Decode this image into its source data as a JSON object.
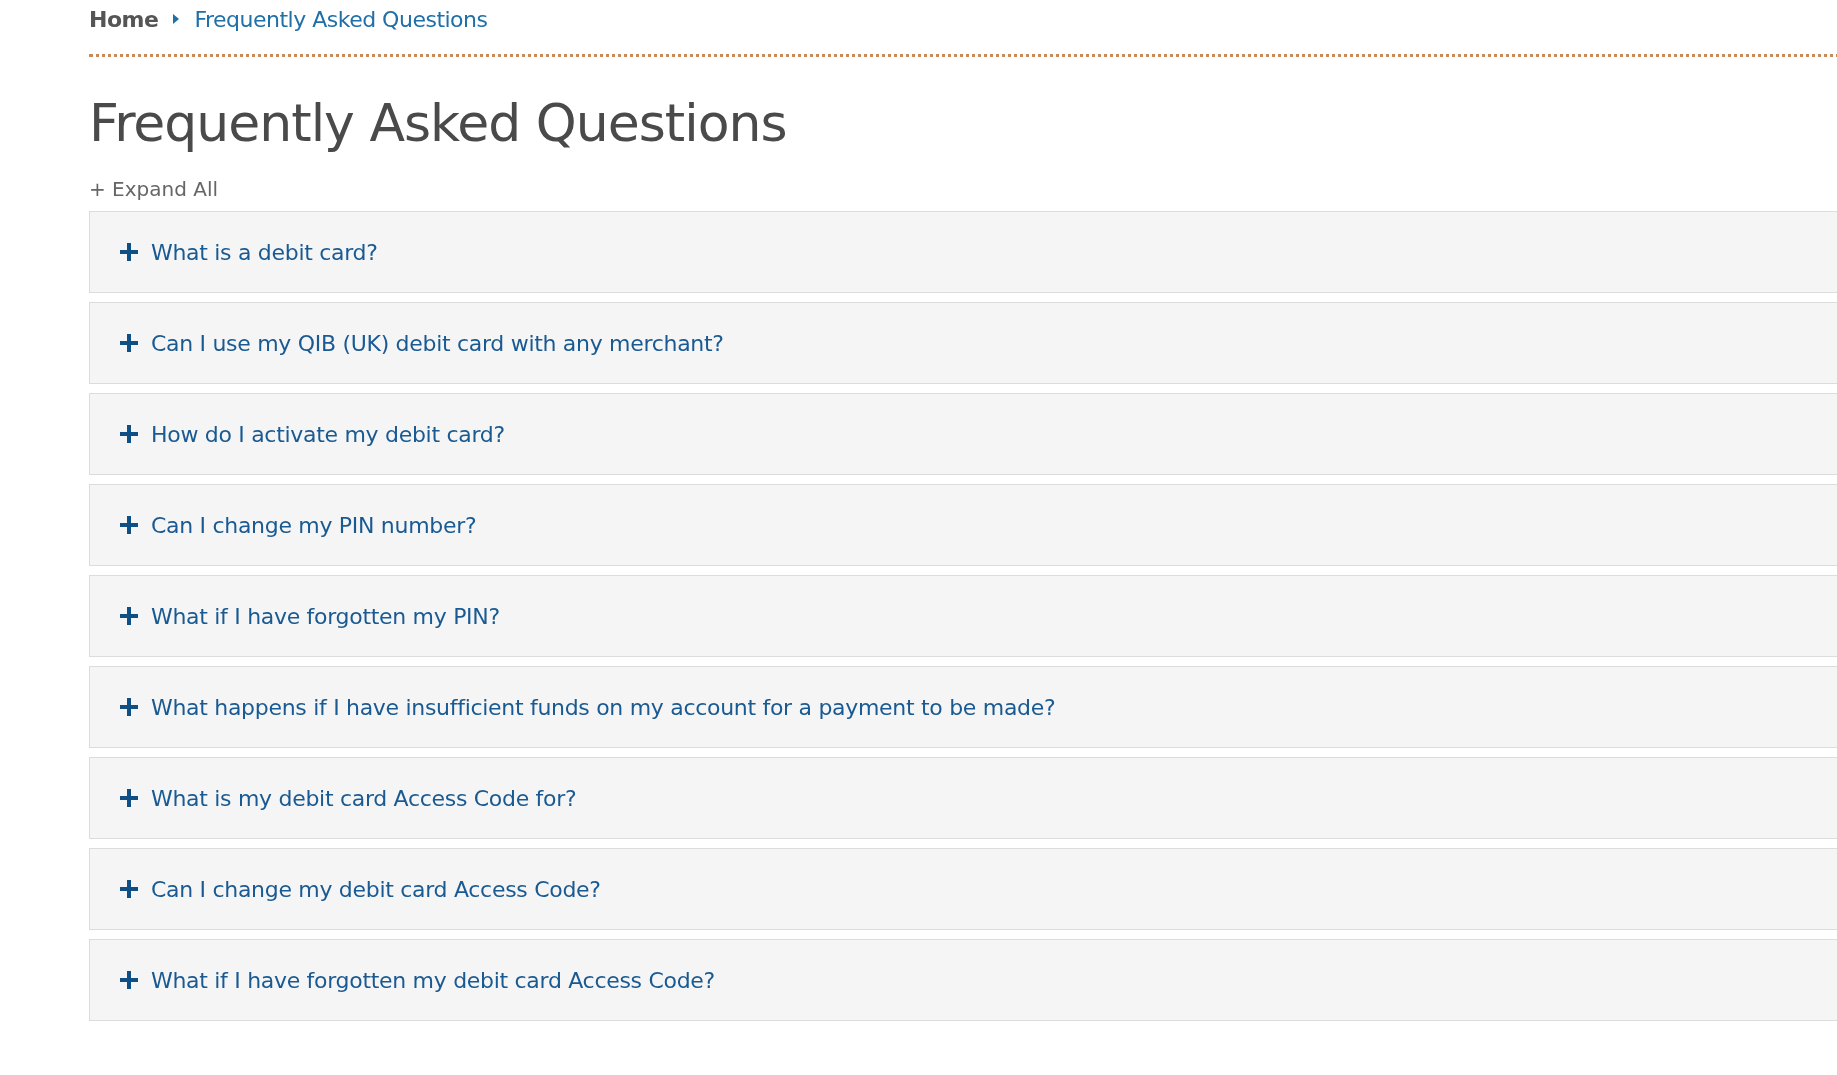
{
  "breadcrumb": {
    "home": "Home",
    "current": "Frequently Asked Questions"
  },
  "title": "Frequently Asked Questions",
  "expand_all": "+ Expand All",
  "questions": [
    {
      "text": "What is a debit card?",
      "expanded": false
    },
    {
      "text": "Can I use my QIB (UK) debit card with any merchant?",
      "expanded": false
    },
    {
      "text": "How do I activate my debit card?",
      "expanded": false
    },
    {
      "text": "Can I change my PIN number?",
      "expanded": false
    },
    {
      "text": "What if I have forgotten my PIN?",
      "expanded": false
    },
    {
      "text": "What happens if I have insufficient funds on my account for a payment to be made?",
      "expanded": false
    },
    {
      "text": "What is my debit card Access Code for?",
      "expanded": false
    },
    {
      "text": "Can I change my debit card Access Code?",
      "expanded": false
    },
    {
      "text": "What if I have forgotten my debit card Access Code?",
      "expanded": false
    }
  ]
}
